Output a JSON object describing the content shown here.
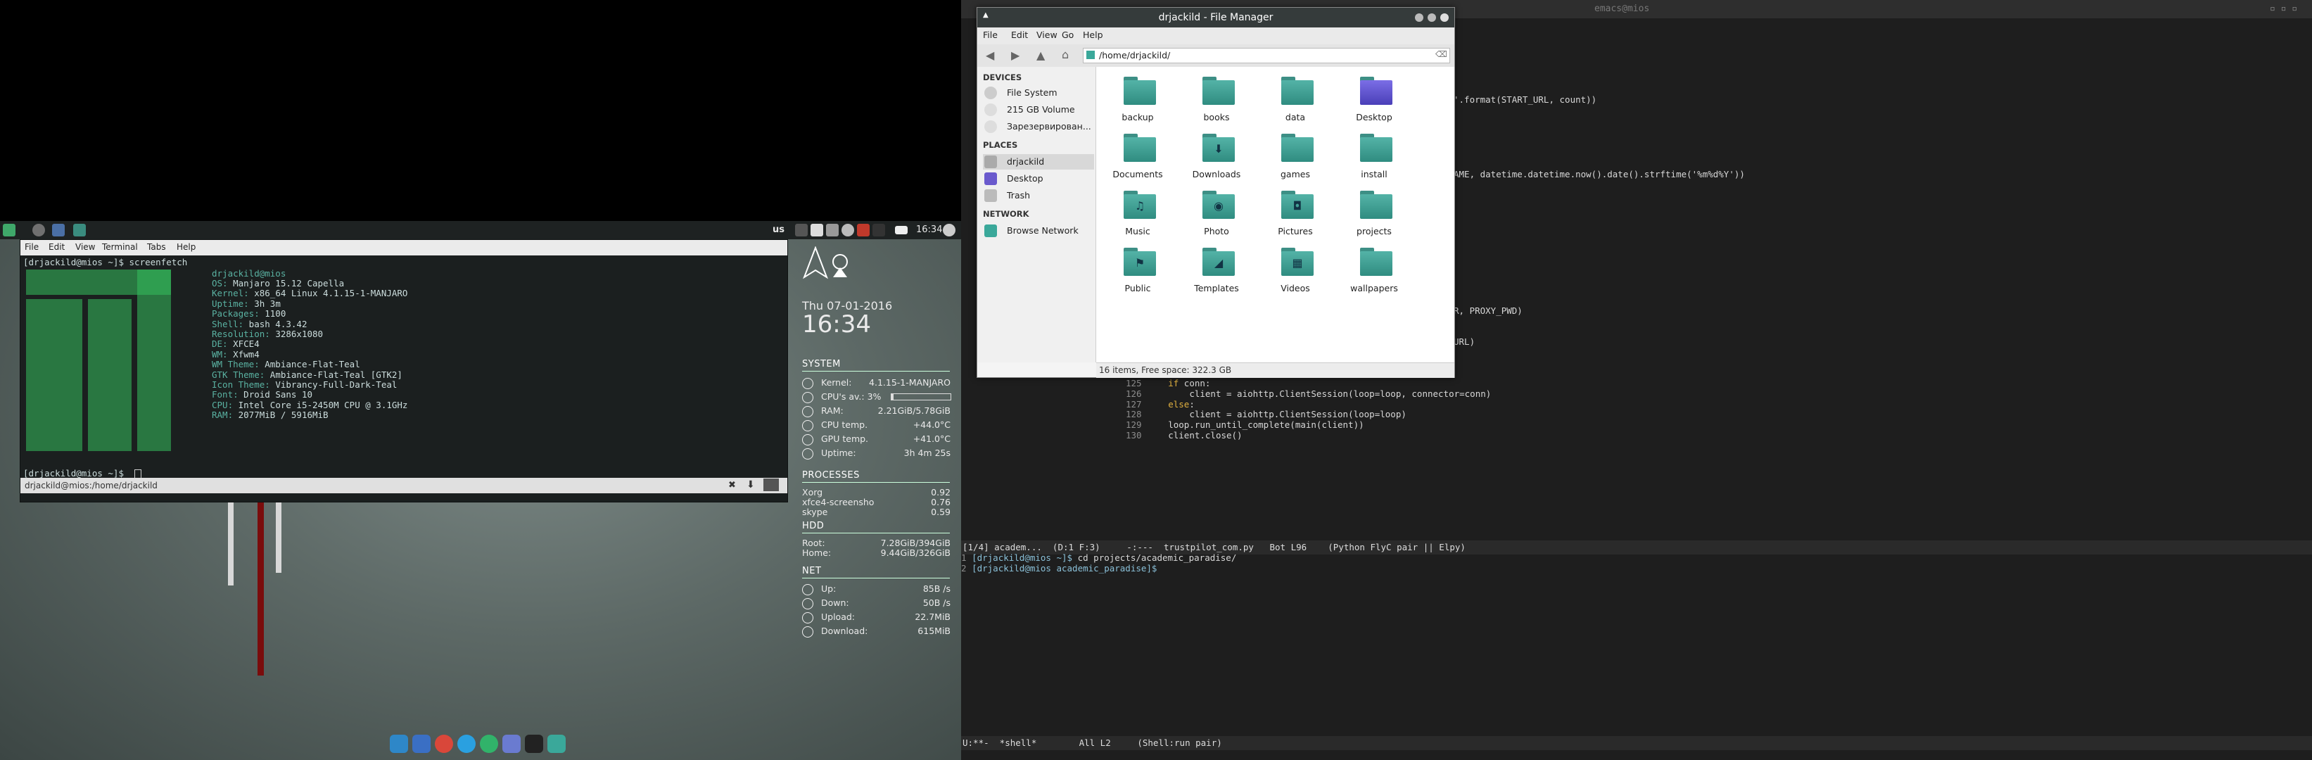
{
  "colors": {
    "accent": "#3aa89a",
    "panel_bg": "#1e2222",
    "terminal_bg": "#1b1f1f",
    "emacs_bg": "#1e1e1e"
  },
  "top_panel": {
    "keyboard_layout": "us",
    "clock": "16:34",
    "tray_icons": [
      "bluetooth-icon",
      "display-icon",
      "volume-icon",
      "settings-icon",
      "update-icon",
      "terminal-icon",
      "battery-icon",
      "power-icon"
    ]
  },
  "terminal": {
    "menu": [
      "File",
      "Edit",
      "View",
      "Terminal",
      "Tabs",
      "Help"
    ],
    "prompt_line": "[drjackild@mios ~]$ screenfetch",
    "user_host": "drjackild@mios",
    "info": [
      {
        "key": "OS:",
        "value": " Manjaro 15.12 Capella"
      },
      {
        "key": "Kernel:",
        "value": " x86_64 Linux 4.1.15-1-MANJARO"
      },
      {
        "key": "Uptime:",
        "value": " 3h 3m"
      },
      {
        "key": "Packages:",
        "value": " 1100"
      },
      {
        "key": "Shell:",
        "value": " bash 4.3.42"
      },
      {
        "key": "Resolution:",
        "value": " 3286x1080"
      },
      {
        "key": "DE:",
        "value": " XFCE4"
      },
      {
        "key": "WM:",
        "value": " Xfwm4"
      },
      {
        "key": "WM Theme:",
        "value": " Ambiance-Flat-Teal"
      },
      {
        "key": "GTK Theme:",
        "value": " Ambiance-Flat-Teal [GTK2]"
      },
      {
        "key": "Icon Theme:",
        "value": " Vibrancy-Full-Dark-Teal"
      },
      {
        "key": "Font:",
        "value": " Droid Sans 10"
      },
      {
        "key": "CPU:",
        "value": " Intel Core i5-2450M CPU @ 3.1GHz"
      },
      {
        "key": "RAM:",
        "value": " 2077MiB / 5916MiB"
      }
    ],
    "final_prompt": "[drjackild@mios ~]$ ",
    "status_path": "drjackild@mios:/home/drjackild"
  },
  "conky": {
    "date": "Thu 07-01-2016",
    "time": "16:34",
    "system_title": "SYSTEM",
    "system": [
      {
        "label": "Kernel:",
        "value": "4.1.15-1-MANJARO"
      },
      {
        "label": "CPU's av.: 3%",
        "value": ""
      },
      {
        "label": "RAM:",
        "value": "2.21GiB/5.78GiB"
      },
      {
        "label": "CPU temp.",
        "value": "+44.0°C"
      },
      {
        "label": "GPU temp.",
        "value": "+41.0°C"
      },
      {
        "label": "Uptime:",
        "value": "3h 4m 25s"
      }
    ],
    "cpu_load": 0.03,
    "processes_title": "PROCESSES",
    "processes": [
      {
        "name": "Xorg",
        "value": "0.92"
      },
      {
        "name": "xfce4-screensho",
        "value": "0.76"
      },
      {
        "name": "skype",
        "value": "0.59"
      }
    ],
    "hdd_title": "HDD",
    "hdd": [
      {
        "label": "Root:",
        "value": "7.28GiB/394GiB"
      },
      {
        "label": "Home:",
        "value": "9.44GiB/326GiB"
      }
    ],
    "net_title": "NET",
    "net": [
      {
        "label": "Up:",
        "value": "85B  /s"
      },
      {
        "label": "Down:",
        "value": "50B  /s"
      },
      {
        "label": "Upload:",
        "value": "22.7MiB"
      },
      {
        "label": "Download:",
        "value": "615MiB"
      }
    ]
  },
  "file_manager": {
    "title": "drjackild - File Manager",
    "menu": [
      "File",
      "Edit",
      "View",
      "Go",
      "Help"
    ],
    "path": "/home/drjackild/",
    "devices_title": "DEVICES",
    "devices": [
      "File System",
      "215 GB Volume",
      "Зарезервирован..."
    ],
    "places_title": "PLACES",
    "places": [
      "drjackild",
      "Desktop",
      "Trash"
    ],
    "network_title": "NETWORK",
    "network": [
      "Browse Network"
    ],
    "folders": [
      "backup",
      "books",
      "data",
      "Desktop",
      "Documents",
      "Downloads",
      "games",
      "install",
      "Music",
      "Photo",
      "Pictures",
      "projects",
      "Public",
      "Templates",
      "Videos",
      "wallpapers"
    ],
    "status": "16 items, Free space: 322.3 GB"
  },
  "emacs": {
    "title": "emacs@mios",
    "frag1": "'.format(START_URL, count))",
    "frag2": "AME, datetime.datetime.now().date().strftime('%m%d%Y'))",
    "frag3": "R, PROXY_PWD)",
    "frag4": "URL)",
    "code": [
      {
        "n": "125",
        "parts": [
          {
            "t": "    "
          },
          {
            "t": "if",
            "c": "kw"
          },
          {
            "t": " conn:"
          }
        ]
      },
      {
        "n": "126",
        "parts": [
          {
            "t": "        client = aiohttp.ClientSession(loop=loop, connector=conn)"
          }
        ]
      },
      {
        "n": "127",
        "parts": [
          {
            "t": "    "
          },
          {
            "t": "else",
            "c": "kw"
          },
          {
            "t": ":"
          }
        ]
      },
      {
        "n": "128",
        "parts": [
          {
            "t": "        client = aiohttp.ClientSession(loop=loop)"
          }
        ]
      },
      {
        "n": "129",
        "parts": [
          {
            "t": "    loop.run_until_complete(main(client))"
          }
        ]
      },
      {
        "n": "130",
        "parts": [
          {
            "t": "    client.close()"
          }
        ]
      }
    ],
    "modeline1": "[1/4] academ...  (D:1 F:3)     -:---  trustpilot_com.py   Bot L96    (Python FlyC pair || Elpy)",
    "shell_lines": [
      {
        "n": "1",
        "prompt": "[drjackild@mios ~]$",
        "cmd": " cd projects/academic_paradise/"
      },
      {
        "n": "2",
        "prompt": "[drjackild@mios academic_paradise]$",
        "cmd": " "
      }
    ],
    "modeline2": "U:**-  *shell*        All L2     (Shell:run pair)"
  }
}
